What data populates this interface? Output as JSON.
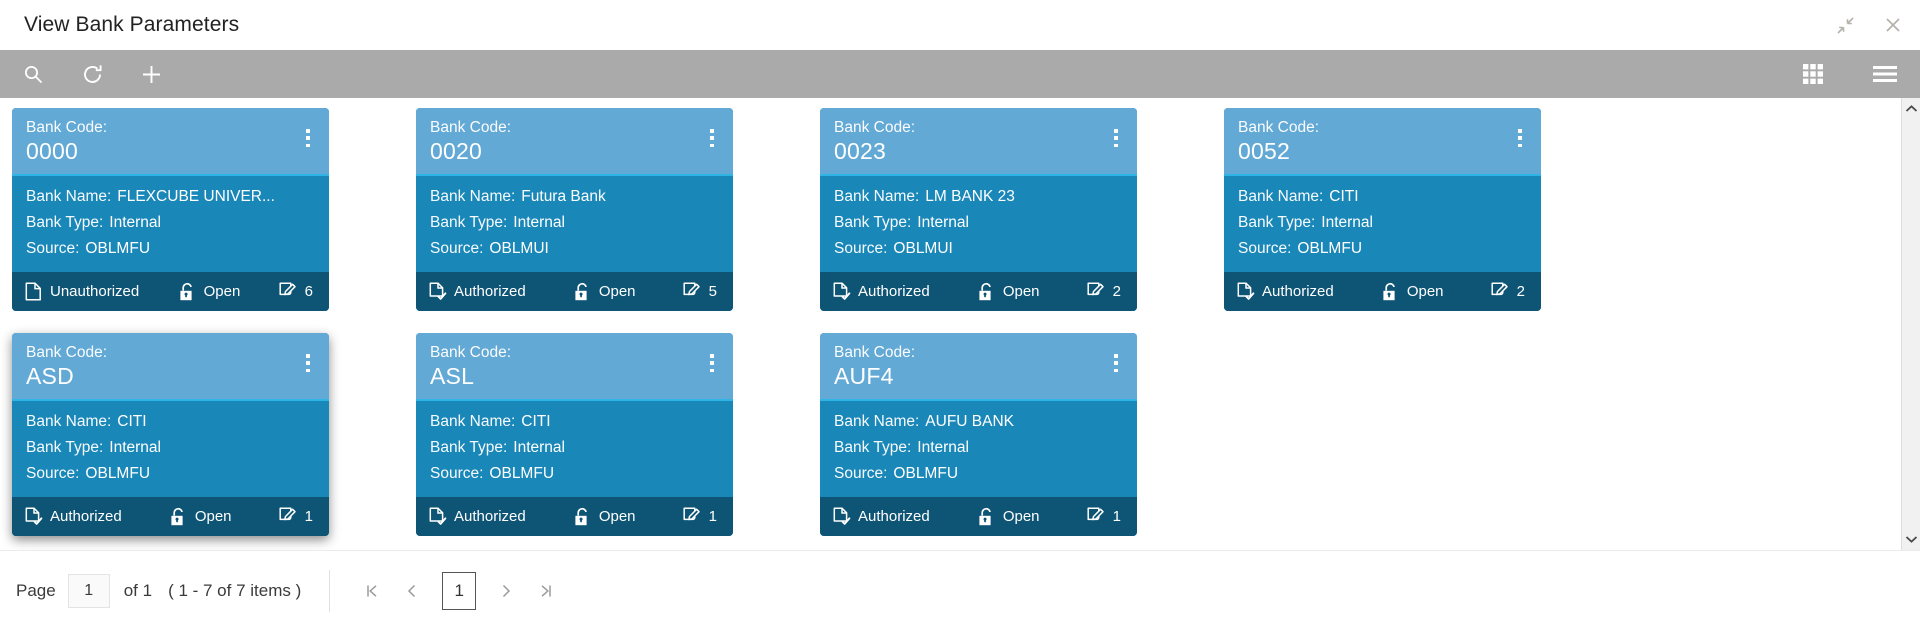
{
  "window": {
    "title": "View Bank Parameters",
    "actions": [
      {
        "name": "collapse-icon",
        "label": "Collapse"
      },
      {
        "name": "close-icon",
        "label": "Close"
      }
    ]
  },
  "toolbar": {
    "left": [
      {
        "name": "search-icon",
        "label": "Search"
      },
      {
        "name": "refresh-icon",
        "label": "Refresh"
      },
      {
        "name": "add-icon",
        "label": "Add"
      }
    ],
    "right": [
      {
        "name": "grid-view-icon",
        "label": "Grid View"
      },
      {
        "name": "list-menu-icon",
        "label": "Menu"
      }
    ]
  },
  "labels": {
    "bank_code": "Bank Code:",
    "bank_name": "Bank Name:",
    "bank_type": "Bank Type:",
    "source": "Source:"
  },
  "colors": {
    "card_header": "#63a9d6",
    "card_body": "#1a87b9",
    "card_footer": "#0d5475",
    "header_rule": "#2fb4e6",
    "toolbar": "#aaaaaa"
  },
  "cards": [
    {
      "code": "0000",
      "bank_name": "FLEXCUBE UNIVER...",
      "bank_type": "Internal",
      "source": "OBLMFU",
      "status": "Unauthorized",
      "lock": "Open",
      "count": "6",
      "active": false
    },
    {
      "code": "0020",
      "bank_name": "Futura Bank",
      "bank_type": "Internal",
      "source": "OBLMUI",
      "status": "Authorized",
      "lock": "Open",
      "count": "5",
      "active": false
    },
    {
      "code": "0023",
      "bank_name": "LM BANK 23",
      "bank_type": "Internal",
      "source": "OBLMUI",
      "status": "Authorized",
      "lock": "Open",
      "count": "2",
      "active": false
    },
    {
      "code": "0052",
      "bank_name": "CITI",
      "bank_type": "Internal",
      "source": "OBLMFU",
      "status": "Authorized",
      "lock": "Open",
      "count": "2",
      "active": false
    },
    {
      "code": "ASD",
      "bank_name": "CITI",
      "bank_type": "Internal",
      "source": "OBLMFU",
      "status": "Authorized",
      "lock": "Open",
      "count": "1",
      "active": true
    },
    {
      "code": "ASL",
      "bank_name": "CITI",
      "bank_type": "Internal",
      "source": "OBLMFU",
      "status": "Authorized",
      "lock": "Open",
      "count": "1",
      "active": false
    },
    {
      "code": "AUF4",
      "bank_name": "AUFU BANK",
      "bank_type": "Internal",
      "source": "OBLMFU",
      "status": "Authorized",
      "lock": "Open",
      "count": "1",
      "active": false
    }
  ],
  "pagination": {
    "page_label": "Page",
    "page_value": "1",
    "of_text": "of 1",
    "range_text": "( 1 - 7 of 7 items )",
    "current_page": "1",
    "nav": {
      "first": "first-page-icon",
      "prev": "prev-page-icon",
      "next": "next-page-icon",
      "last": "last-page-icon"
    }
  }
}
